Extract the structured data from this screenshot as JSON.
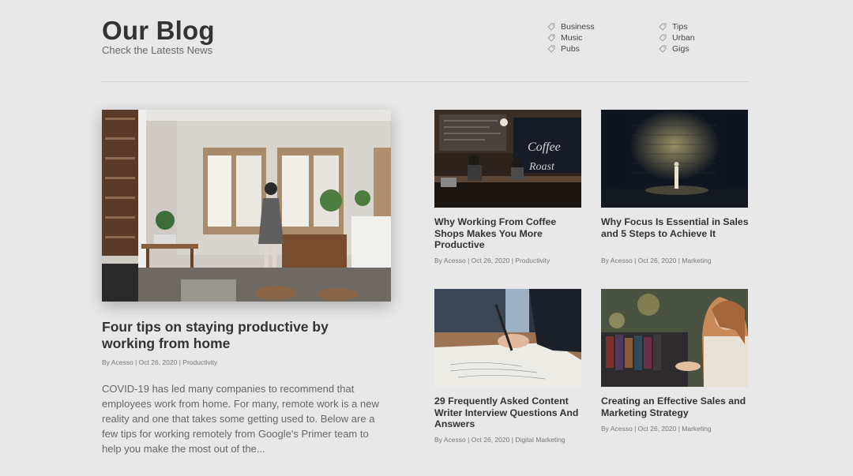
{
  "header": {
    "title": "Our Blog",
    "subtitle": "Check the Latests News"
  },
  "categories": {
    "col1": [
      "Business",
      "Music",
      "Pubs"
    ],
    "col2": [
      "Tips",
      "Urban",
      "Gigs"
    ]
  },
  "featured": {
    "image": "home-office-photo",
    "title": "Four tips on staying productive by working from home",
    "author": "By Acesso",
    "date": "Oct 26, 2020",
    "category": "Productivity",
    "excerpt": "COVID-19 has led many companies to recommend that employees work from home. For many, remote work is a new reality and one that takes some getting used to. Below are a few tips for working remotely from Google's Primer team to help you make the most out of the..."
  },
  "posts": [
    {
      "image": "coffee-shop-photo",
      "title": "Why Working From Coffee Shops Makes You More Productive",
      "author": "By Acesso",
      "date": "Oct 26, 2020",
      "category": "Productivity"
    },
    {
      "image": "spotlight-photo",
      "title": "Why Focus Is Essential in Sales and 5 Steps to Achieve It",
      "author": "By Acesso",
      "date": "Oct 26, 2020",
      "category": "Marketing"
    },
    {
      "image": "writing-photo",
      "title": "29 Frequently Asked Content Writer Interview Questions And Answers",
      "author": "By Acesso",
      "date": "Oct 26, 2020",
      "category": "Digital Marketing"
    },
    {
      "image": "shopping-photo",
      "title": "Creating an Effective Sales and Marketing Strategy",
      "author": "By Acesso",
      "date": "Oct 26, 2020",
      "category": "Marketing"
    }
  ],
  "separator": "|"
}
